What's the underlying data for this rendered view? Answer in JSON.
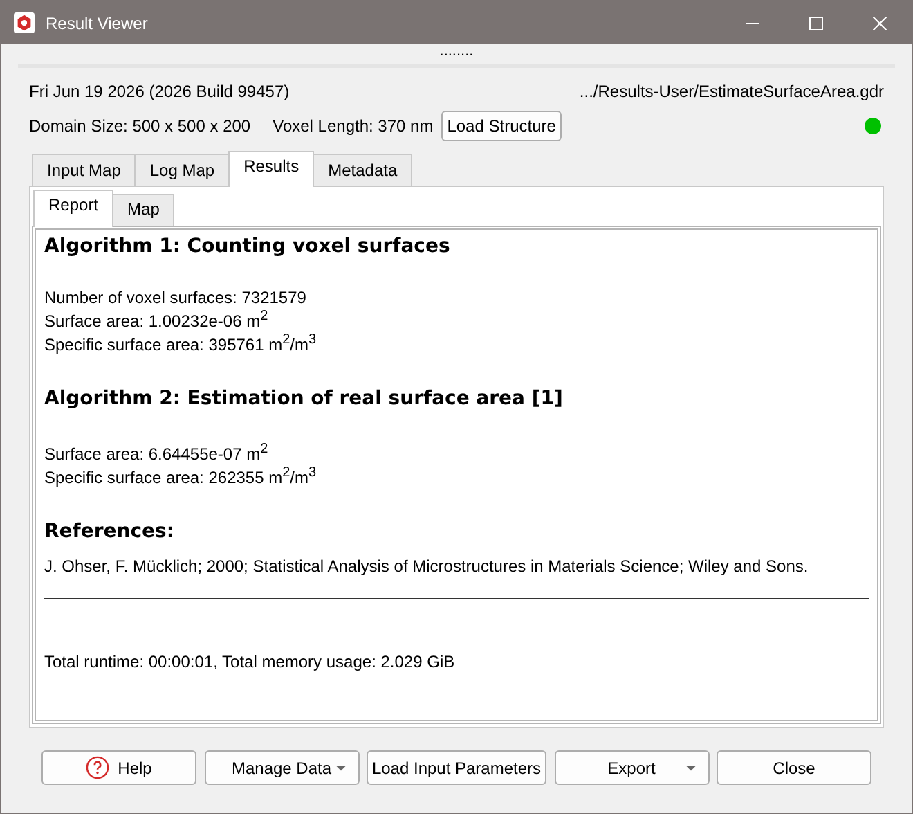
{
  "window": {
    "title": "Result Viewer"
  },
  "splitter": "........",
  "info": {
    "date": "Fri Jun 19 2026 (2026 Build 99457)",
    "path": ".../Results-User/EstimateSurfaceArea.gdr",
    "domain": "Domain Size: 500 x 500 x 200",
    "voxel": "Voxel Length: 370 nm",
    "load_button": "Load Structure",
    "status_dot": {
      "color": "#00c000"
    }
  },
  "tabs": [
    {
      "label": "Input Map",
      "selected": false
    },
    {
      "label": "Log Map",
      "selected": false
    },
    {
      "label": "Results",
      "selected": true
    },
    {
      "label": "Metadata",
      "selected": false
    }
  ],
  "subtabs": [
    {
      "label": "Report",
      "selected": true
    },
    {
      "label": "Map",
      "selected": false
    }
  ],
  "report": [
    {
      "kind": "heading",
      "text": "Algorithm 1: Counting voxel surfaces"
    },
    {
      "kind": "lines",
      "lines": [
        "Number of voxel surfaces: 7321579",
        "Surface area: 1.00232e-06 m$^{2}$",
        "Specific surface area: 395761 m$^{2}$/m$^{3}$"
      ]
    },
    {
      "kind": "heading",
      "text": "Algorithm 2: Estimation of real surface area [1]"
    },
    {
      "kind": "lines",
      "lines": [
        "Surface area: 6.64455e-07 m$^{2}$",
        "Specific surface area: 262355 m$^{2}$/m$^{3}$"
      ]
    },
    {
      "kind": "subheading",
      "text": "References:"
    },
    {
      "kind": "reference",
      "text": "J. Ohser, F. Mücklich; 2000; Statistical Analysis of Microstructures in Materials Science; Wiley and Sons."
    },
    {
      "kind": "rule"
    },
    {
      "kind": "footer",
      "text": "Total runtime: 00:00:01, Total memory usage: 2.029 GiB"
    }
  ],
  "buttons": [
    {
      "label": "Help",
      "kind": "help"
    },
    {
      "label": "Manage Data",
      "kind": "menu"
    },
    {
      "label": "Load Input Parameters",
      "kind": "plain"
    },
    {
      "label": "Export",
      "kind": "menu"
    },
    {
      "label": "Close",
      "kind": "plain"
    }
  ]
}
